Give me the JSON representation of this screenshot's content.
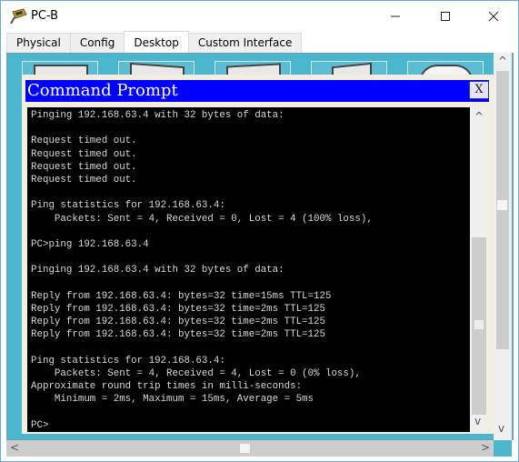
{
  "window": {
    "title": "PC-B",
    "minimize_icon": "minimize-icon",
    "maximize_icon": "maximize-icon",
    "close_icon": "close-icon",
    "app_icon": "packet-tracer-pc-icon"
  },
  "tabs": [
    {
      "label": "Physical",
      "active": false
    },
    {
      "label": "Config",
      "active": false
    },
    {
      "label": "Desktop",
      "active": true
    },
    {
      "label": "Custom Interface",
      "active": false
    }
  ],
  "command_prompt": {
    "title": "Command Prompt",
    "close_label": "X",
    "lines": [
      "Pinging 192.168.63.4 with 32 bytes of data:",
      "",
      "Request timed out.",
      "Request timed out.",
      "Request timed out.",
      "Request timed out.",
      "",
      "Ping statistics for 192.168.63.4:",
      "    Packets: Sent = 4, Received = 0, Lost = 4 (100% loss),",
      "",
      "PC>ping 192.168.63.4",
      "",
      "Pinging 192.168.63.4 with 32 bytes of data:",
      "",
      "Reply from 192.168.63.4: bytes=32 time=15ms TTL=125",
      "Reply from 192.168.63.4: bytes=32 time=2ms TTL=125",
      "Reply from 192.168.63.4: bytes=32 time=2ms TTL=125",
      "Reply from 192.168.63.4: bytes=32 time=2ms TTL=125",
      "",
      "Ping statistics for 192.168.63.4:",
      "    Packets: Sent = 4, Received = 4, Lost = 0 (0% loss),",
      "Approximate round trip times in milli-seconds:",
      "    Minimum = 2ms, Maximum = 15ms, Average = 5ms",
      "",
      "PC>"
    ]
  },
  "scrollbars": {
    "up_arrow": "^",
    "down_arrow": "v",
    "left_arrow": "<",
    "right_arrow": ">"
  }
}
